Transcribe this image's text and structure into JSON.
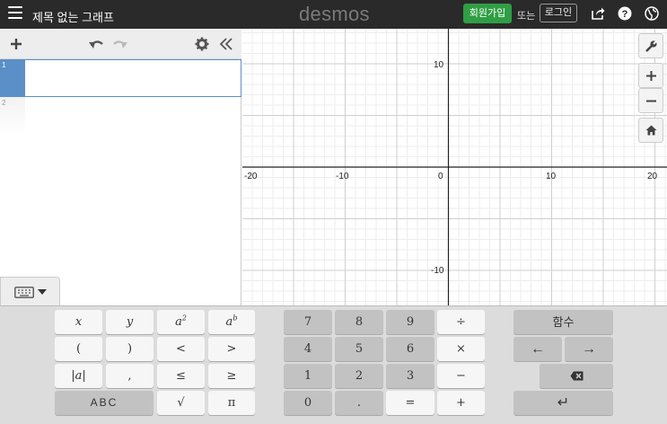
{
  "header": {
    "title": "제목 없는 그래프",
    "logo": "desmos",
    "signup_label": "회원가입",
    "or_text": "또는",
    "login_label": "로그인"
  },
  "expressions": {
    "rows": [
      {
        "index": "1",
        "value": ""
      },
      {
        "index": "2",
        "value": ""
      }
    ]
  },
  "graph": {
    "x_ticks": [
      "-20",
      "-10",
      "0",
      "10",
      "20"
    ],
    "y_ticks": [
      "10",
      "-10"
    ]
  },
  "keypad": {
    "left": [
      [
        "x",
        "y",
        "a",
        "a"
      ],
      [
        "(",
        ")",
        "<",
        ">"
      ],
      [
        "|a|",
        ",",
        "≤",
        "≥"
      ],
      [
        "ABC",
        "√",
        "π"
      ]
    ],
    "left_superscripts": [
      "2",
      "b"
    ],
    "center": [
      [
        "7",
        "8",
        "9",
        "÷"
      ],
      [
        "4",
        "5",
        "6",
        "×"
      ],
      [
        "1",
        "2",
        "3",
        "−"
      ],
      [
        "0",
        ".",
        "=",
        "+"
      ]
    ],
    "right": {
      "functions_label": "함수",
      "left_arrow": "←",
      "right_arrow": "→",
      "enter": "↵"
    }
  }
}
